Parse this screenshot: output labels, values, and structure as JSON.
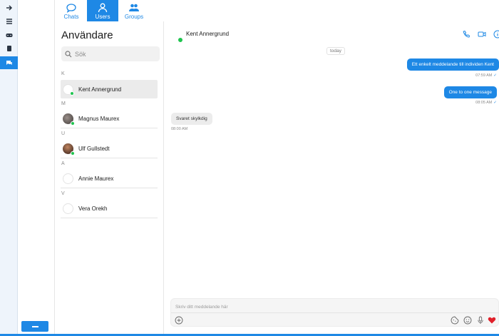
{
  "nav_rail": {
    "items": [
      {
        "icon": "arrow-right-icon"
      },
      {
        "icon": "list-icon"
      },
      {
        "icon": "gamepad-icon"
      },
      {
        "icon": "book-icon"
      },
      {
        "icon": "chat-bubbles-icon",
        "active": true
      }
    ]
  },
  "tabs": [
    {
      "label": "Chats",
      "icon": "chat-bubble-icon"
    },
    {
      "label": "Users",
      "icon": "user-icon",
      "active": true
    },
    {
      "label": "Groups",
      "icon": "group-icon"
    }
  ],
  "users_panel": {
    "title": "Användare",
    "search_placeholder": "Sök",
    "sections": [
      {
        "letter": "K",
        "users": [
          {
            "name": "Kent Annergrund",
            "online": true,
            "selected": true
          }
        ]
      },
      {
        "letter": "M",
        "users": [
          {
            "name": "Magnus Maurex",
            "online": true
          }
        ]
      },
      {
        "letter": "U",
        "users": [
          {
            "name": "Ulf Gullstedt",
            "online": true
          }
        ]
      },
      {
        "letter": "A",
        "users": [
          {
            "name": "Annie Maurex",
            "online": false
          }
        ]
      },
      {
        "letter": "V",
        "users": [
          {
            "name": "Vera Orekh",
            "online": false
          }
        ]
      }
    ]
  },
  "chat": {
    "contact_name": "Kent Annergrund",
    "date_label": "today",
    "messages": [
      {
        "direction": "out",
        "text": "Ett enkelt meddelande till individen Kent",
        "time": "07:59 AM",
        "read": true
      },
      {
        "direction": "out",
        "text": "One to one message",
        "time": "08:05 AM",
        "read": true
      },
      {
        "direction": "in",
        "text": "Svaret skylkdig",
        "time": "08:00 AM"
      }
    ],
    "composer_placeholder": "Skriv ditt meddelande här"
  },
  "colors": {
    "accent": "#1e88e5",
    "online": "#1fc44f",
    "heart": "#e0202a"
  }
}
